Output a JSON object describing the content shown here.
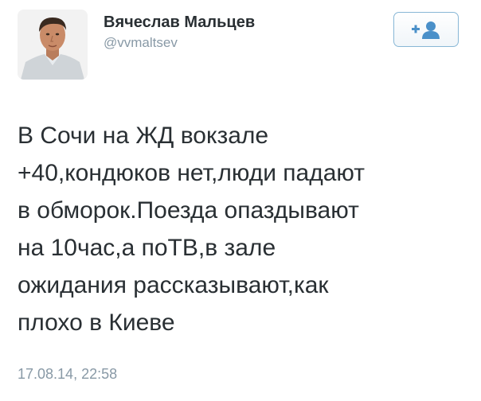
{
  "author": {
    "display_name": "Вячеслав Мальцев",
    "username": "@vvmaltsev"
  },
  "follow_button": {
    "icon": "add-user-icon",
    "accent_color": "#4a90c9"
  },
  "tweet": {
    "lines": [
      "В Сочи на ЖД вокзале",
      "+40,кондюков нет,люди падают",
      "в обморок.Поезда опаздывают",
      "на 10час,а поТВ,в зале",
      "ожидания рассказывают,как",
      "плохо в Киеве"
    ],
    "timestamp": "17.08.14, 22:58"
  },
  "colors": {
    "text": "#292f33",
    "secondary_text": "#8899a6",
    "button_border": "#88b7d6"
  }
}
